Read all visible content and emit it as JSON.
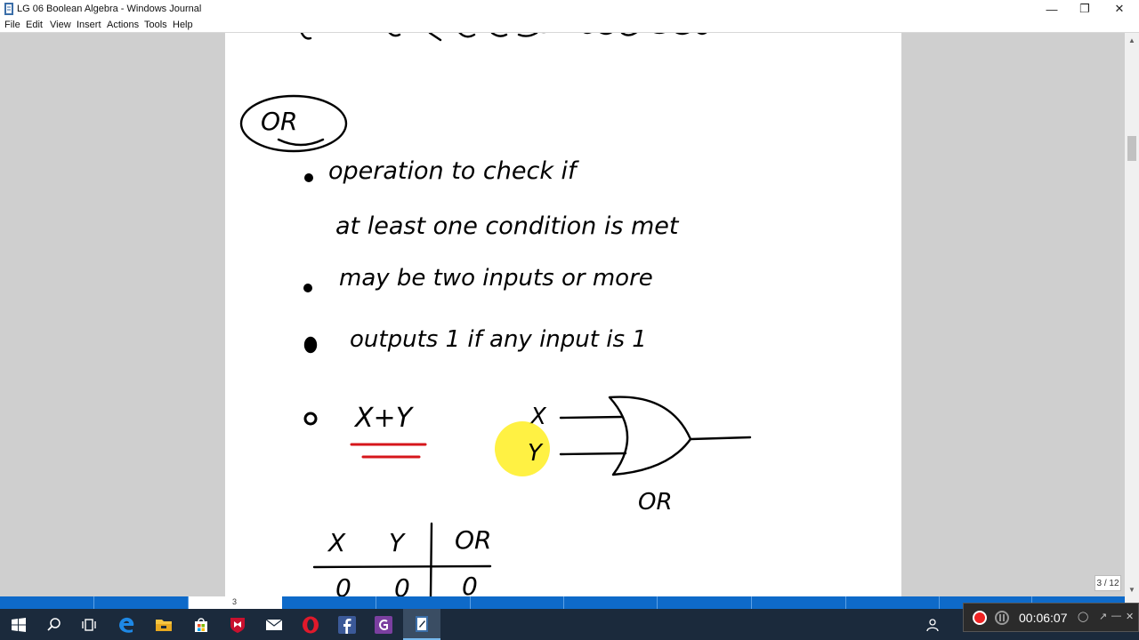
{
  "window": {
    "title": "LG 06 Boolean Algebra - Windows Journal"
  },
  "menu": [
    "File",
    "Edit",
    "View",
    "Insert",
    "Actions",
    "Tools",
    "Help"
  ],
  "note": {
    "heading": "OR",
    "bullet1_line1": "operation to check if",
    "bullet1_line2": "at least one condition is met",
    "bullet2": "may be two inputs or more",
    "bullet3": "outputs 1 if any input is 1",
    "expression": "X+Y",
    "gate_input_x": "X",
    "gate_input_y": "Y",
    "gate_label": "OR",
    "table": {
      "headers": [
        "X",
        "Y",
        "OR"
      ],
      "row1": [
        "0",
        "0",
        "0"
      ]
    }
  },
  "page_indicator": "3 / 12",
  "pagebar": {
    "current_page": "3"
  },
  "recorder": {
    "time": "00:06:07"
  },
  "colors": {
    "underline": "#d6161b",
    "highlighter": "#ffee22",
    "pagebar": "#0e6ac9",
    "taskbar": "#1b2a3c"
  },
  "taskbar_icons": [
    "windows-start-icon",
    "search-icon",
    "task-view-icon",
    "edge-icon",
    "file-explorer-icon",
    "store-icon",
    "mcafee-icon",
    "mail-icon",
    "opera-icon",
    "facebook-icon",
    "pdf-icon",
    "windows-journal-icon"
  ]
}
